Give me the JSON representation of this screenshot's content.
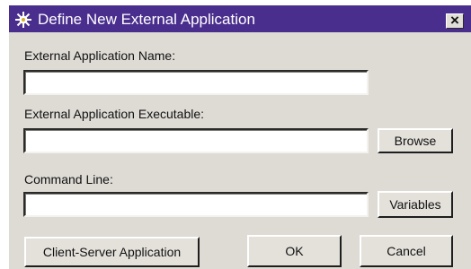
{
  "window": {
    "title": "Define New External Application",
    "close_label": "×",
    "app_icon": "gear-star-icon"
  },
  "form": {
    "name_label": "External Application Name:",
    "name_value": "",
    "executable_label": "External Application Executable:",
    "executable_value": "",
    "browse_label": "Browse",
    "command_label": "Command Line:",
    "command_value": "",
    "variables_label": "Variables"
  },
  "footer": {
    "client_server_label": "Client-Server Application",
    "ok_label": "OK",
    "cancel_label": "Cancel"
  },
  "colors": {
    "titlebar": "#4a2e8e",
    "dialog_bg": "#dedbd5"
  }
}
